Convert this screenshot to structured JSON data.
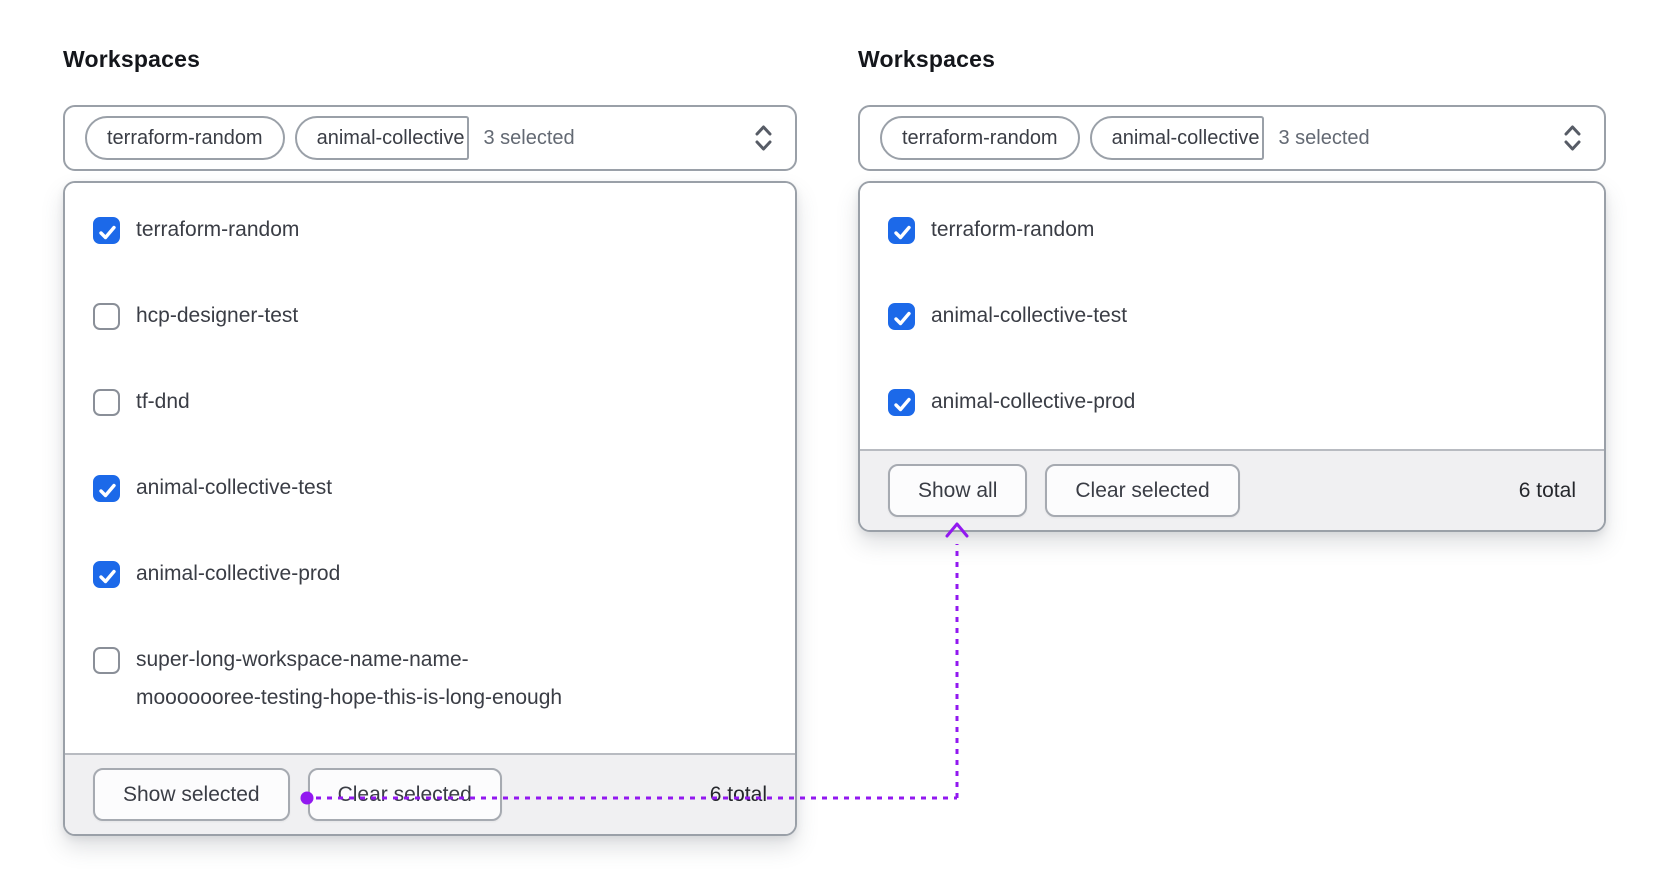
{
  "colors": {
    "checkbox_blue": "#1c69e9",
    "annotation_purple": "#9218f0",
    "panel_border_gray": "#9aa0a8",
    "footer_bg": "#f0f0f2"
  },
  "left_panel": {
    "label": "Workspaces",
    "toggle": {
      "tags": [
        "terraform-random",
        "animal-collective"
      ],
      "summary": "3 selected"
    },
    "items": [
      {
        "label": "terraform-random",
        "checked": true
      },
      {
        "label": "hcp-designer-test",
        "checked": false
      },
      {
        "label": "tf-dnd",
        "checked": false
      },
      {
        "label": "animal-collective-test",
        "checked": true
      },
      {
        "label": "animal-collective-prod",
        "checked": true
      },
      {
        "label": "super-long-workspace-name-name-mooooooree-testing-hope-this-is-long-enough",
        "checked": false,
        "lines": [
          "super-long-workspace-name-name-",
          "mooooooree-testing-hope-this-is-long-enough"
        ]
      }
    ],
    "footer": {
      "show_button": "Show selected",
      "clear_button": "Clear selected",
      "total": "6 total"
    }
  },
  "right_panel": {
    "label": "Workspaces",
    "toggle": {
      "tags": [
        "terraform-random",
        "animal-collective"
      ],
      "summary": "3 selected"
    },
    "items": [
      {
        "label": "terraform-random",
        "checked": true
      },
      {
        "label": "animal-collective-test",
        "checked": true
      },
      {
        "label": "animal-collective-prod",
        "checked": true
      }
    ],
    "footer": {
      "show_button": "Show all",
      "clear_button": "Clear selected",
      "total": "6 total"
    }
  }
}
